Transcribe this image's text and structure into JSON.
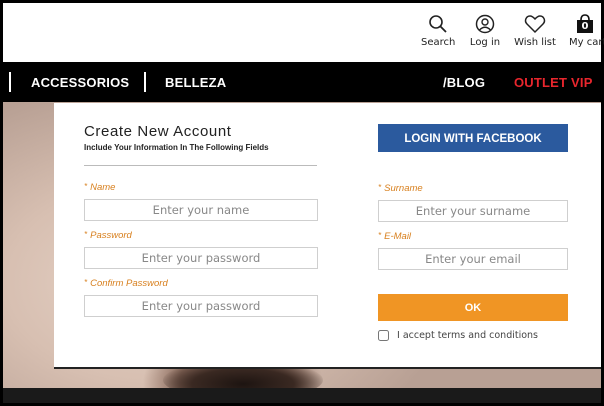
{
  "header": {
    "icons": [
      {
        "name": "search-icon",
        "label": "Search"
      },
      {
        "name": "user-icon",
        "label": "Log in"
      },
      {
        "name": "heart-icon",
        "label": "Wish list"
      },
      {
        "name": "bag-icon",
        "label": "My cart",
        "badge": "0"
      }
    ]
  },
  "nav": {
    "items": [
      "ACCESSORIOS",
      "BELLEZA",
      "/BLOG",
      "OUTLET VIP"
    ],
    "vip_color": "#e8262d"
  },
  "form": {
    "title": "Create New Account",
    "subtitle": "Include Your Information In The Following Fields",
    "facebook_button": "LOGIN WITH FACEBOOK",
    "fields": {
      "name": {
        "label": "Name",
        "placeholder": "Enter your name"
      },
      "surname": {
        "label": "Surname",
        "placeholder": "Enter your surname"
      },
      "password": {
        "label": "Password",
        "placeholder": "Enter your password"
      },
      "email": {
        "label": "E-Mail",
        "placeholder": "Enter your email"
      },
      "confirm_password": {
        "label": "Confirm Password",
        "placeholder": "Enter your password"
      }
    },
    "required_marker": "*",
    "ok_button": "OK",
    "terms_label": "I accept terms and conditions",
    "terms_checked": false
  },
  "colors": {
    "facebook": "#2b5a9e",
    "ok": "#f09524",
    "field_label": "#d8801f"
  }
}
